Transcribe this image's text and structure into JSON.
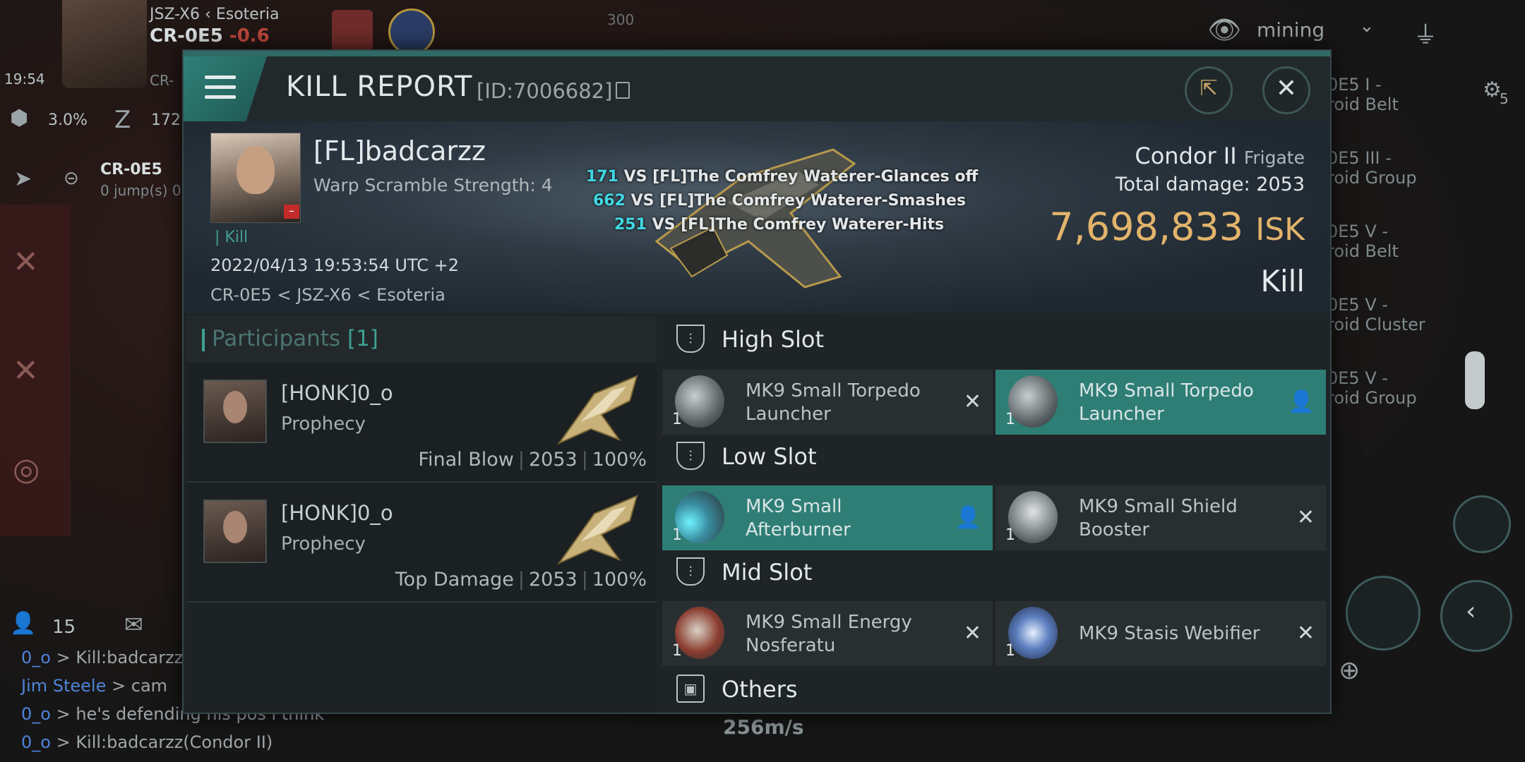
{
  "hud": {
    "system_top": "JSZ-X6",
    "region_top": "Esoteria",
    "system_name": "CR-0E5",
    "security": "-0.6",
    "clock": "19:54",
    "cr_partial": "CR-",
    "stat_pct": "3.0%",
    "stat_num": "172",
    "nav_system": "CR-0E5",
    "nav_jumps": "0 jump(s) 0",
    "number_300": "300",
    "filter_label": "mining",
    "right_list": [
      {
        "line1": "0E5 I -",
        "line2": "roid Belt"
      },
      {
        "line1": "0E5 III -",
        "line2": "roid Group"
      },
      {
        "line1": "0E5 V -",
        "line2": "roid Belt"
      },
      {
        "line1": "0E5 V -",
        "line2": "roid Cluster"
      },
      {
        "line1": "0E5 V -",
        "line2": "roid Group"
      }
    ],
    "right_badge": "5",
    "local_count": "15",
    "speed": "256m/s",
    "chat": [
      {
        "name": "0_o",
        "text": " > Kill:badcarzz"
      },
      {
        "name": "Jim Steele",
        "text": " > cam"
      },
      {
        "name": "0_o",
        "text": " > he's defending his pos i think"
      },
      {
        "name": "0_o",
        "text": " > Kill:badcarzz(Condor II)"
      }
    ],
    "colors": {
      "accent": "#2f8078",
      "isk": "#e2b46b",
      "damage_number": "#3fd8e4"
    }
  },
  "modal": {
    "title": "KILL REPORT",
    "report_id": "[ID:7006682]",
    "victim": {
      "name": "[FL]badcarzz",
      "warp_scramble": "Warp Scramble Strength: 4",
      "tag": "Kill",
      "datetime": "2022/04/13 19:53:54 UTC +2",
      "location": "CR-0E5 < JSZ-X6 < Esoteria"
    },
    "hits": [
      {
        "dmg": "171",
        "text": " VS [FL]The Comfrey Waterer-Glances off"
      },
      {
        "dmg": "662",
        "text": " VS [FL]The Comfrey Waterer-Smashes"
      },
      {
        "dmg": "251",
        "text": " VS [FL]The Comfrey Waterer-Hits"
      }
    ],
    "ship": {
      "name": "Condor II",
      "class": "Frigate",
      "total_damage_label": "Total damage:",
      "total_damage": "2053",
      "isk_value": "7,698,833",
      "isk_unit": "ISK",
      "result": "Kill"
    },
    "participants": {
      "label": "Participants",
      "count": "[1]",
      "rows": [
        {
          "name": "[HONK]0_o",
          "ship": "Prophecy",
          "role": "Final Blow",
          "damage": "2053",
          "percent": "100%"
        },
        {
          "name": "[HONK]0_o",
          "ship": "Prophecy",
          "role": "Top Damage",
          "damage": "2053",
          "percent": "100%"
        }
      ]
    },
    "slots": {
      "high": {
        "label": "High Slot",
        "modules": [
          {
            "name": "MK9 Small Torpedo Launcher",
            "qty": "1",
            "status": "destroyed-icon"
          },
          {
            "name": "MK9 Small Torpedo Launcher",
            "qty": "1",
            "status": "dropped-icon"
          }
        ]
      },
      "low": {
        "label": "Low Slot",
        "modules": [
          {
            "name": "MK9 Small Afterburner",
            "qty": "1",
            "status": "dropped-icon"
          },
          {
            "name": "MK9 Small Shield Booster",
            "qty": "1",
            "status": "destroyed-icon"
          }
        ]
      },
      "mid": {
        "label": "Mid Slot",
        "modules": [
          {
            "name": "MK9 Small Energy Nosferatu",
            "qty": "1",
            "status": "destroyed-icon"
          },
          {
            "name": "MK9 Stasis Webifier",
            "qty": "1",
            "status": "destroyed-icon"
          }
        ]
      },
      "others": {
        "label": "Others"
      }
    }
  }
}
